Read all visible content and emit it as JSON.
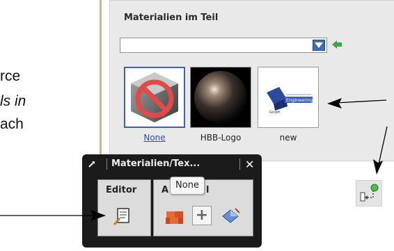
{
  "left_fragments": [
    "rce",
    "ls in",
    "ach"
  ],
  "materials_panel": {
    "title": "Materialien im Teil",
    "combo_value": "",
    "tiles": [
      {
        "label": "None",
        "selected": true,
        "icon": "none-icon"
      },
      {
        "label": "HBB-Logo",
        "selected": false,
        "icon": "dark-sphere-icon"
      },
      {
        "label": "new",
        "selected": false,
        "icon": "engineering-logo-icon"
      }
    ],
    "logo_text": "Engineering"
  },
  "palette": {
    "title": "Materialien/Tex...",
    "sections": [
      "Editor",
      "A"
    ],
    "section_suffix": "l",
    "tooltip": "None"
  },
  "colors": {
    "panel_border": "#e9a88a",
    "selection": "#3f5fa8",
    "palette_bg": "#1b1b1b"
  }
}
